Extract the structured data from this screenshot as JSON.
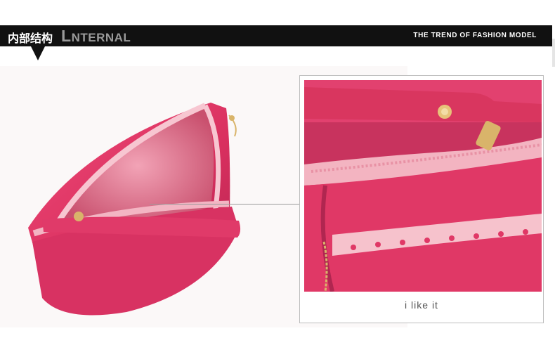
{
  "header": {
    "title_cn": "内部结构",
    "title_en_initial": "L",
    "title_en_rest": "NTERNAL",
    "tagline": "THE TREND OF FASHION MODEL"
  },
  "detail": {
    "caption": "i like it"
  },
  "colors": {
    "banner": "#111111",
    "bag_pink": "#e23a6a",
    "lining": "#f2a7b8",
    "lace": "#f6c2cc",
    "hardware": "#d9b46a"
  }
}
